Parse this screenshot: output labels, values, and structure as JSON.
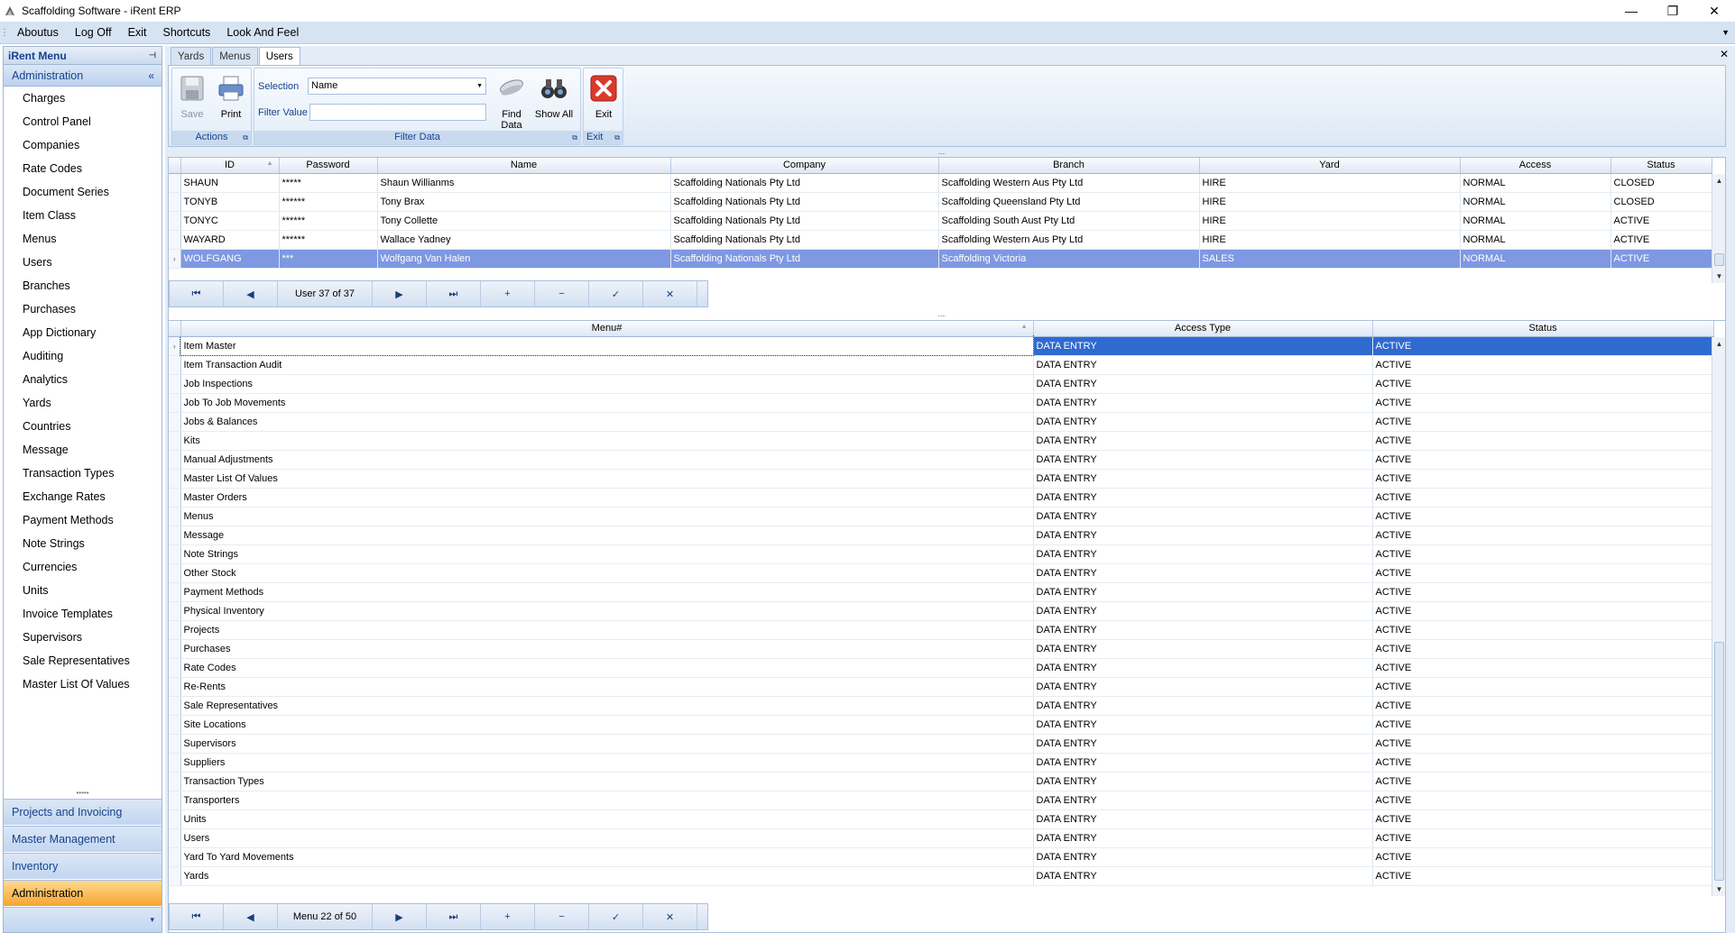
{
  "window": {
    "title": "Scaffolding Software - iRent ERP",
    "controls": [
      "—",
      "❐",
      "✕"
    ]
  },
  "menubar": {
    "items": [
      "Aboutus",
      "Log Off",
      "Exit",
      "Shortcuts",
      "Look And Feel"
    ]
  },
  "nav": {
    "header": "iRent Menu",
    "group": "Administration",
    "items": [
      "Charges",
      "Control Panel",
      "Companies",
      "Rate Codes",
      "Document Series",
      "Item Class",
      "Menus",
      "Users",
      "Branches",
      "Purchases",
      "App Dictionary",
      "Auditing",
      "Analytics",
      "Yards",
      "Countries",
      "Message",
      "Transaction Types",
      "Exchange Rates",
      "Payment Methods",
      "Note Strings",
      "Currencies",
      "Units",
      "Invoice Templates",
      "Supervisors",
      "Sale Representatives",
      "Master List Of Values"
    ],
    "bottom_groups": [
      "Projects and Invoicing",
      "Master Management",
      "Inventory",
      "Administration"
    ]
  },
  "tabs": [
    "Yards",
    "Menus",
    "Users"
  ],
  "ribbon": {
    "actions": {
      "label": "Actions",
      "save": "Save",
      "print": "Print"
    },
    "filter": {
      "label": "Filter Data",
      "selection_label": "Selection",
      "selection_value": "Name",
      "filter_value_label": "Filter Value",
      "filter_value": "",
      "find": "Find Data",
      "show_all": "Show All"
    },
    "exit": {
      "label": "Exit",
      "button": "Exit"
    }
  },
  "users_grid": {
    "columns": [
      "ID",
      "Password",
      "Name",
      "Company",
      "Branch",
      "Yard",
      "Access",
      "Status"
    ],
    "rows": [
      [
        "SHAUN",
        "*****",
        "Shaun Willianms",
        "Scaffolding Nationals Pty Ltd",
        "Scaffolding Western Aus Pty Ltd",
        "HIRE",
        "NORMAL",
        "CLOSED"
      ],
      [
        "TONYB",
        "******",
        "Tony Brax",
        "Scaffolding Nationals Pty Ltd",
        "Scaffolding Queensland Pty Ltd",
        "HIRE",
        "NORMAL",
        "CLOSED"
      ],
      [
        "TONYC",
        "******",
        "Tony Collette",
        "Scaffolding Nationals Pty Ltd",
        "Scaffolding South Aust Pty Ltd",
        "HIRE",
        "NORMAL",
        "ACTIVE"
      ],
      [
        "WAYARD",
        "******",
        "Wallace Yadney",
        "Scaffolding Nationals Pty Ltd",
        "Scaffolding Western Aus Pty Ltd",
        "HIRE",
        "NORMAL",
        "ACTIVE"
      ],
      [
        "WOLFGANG",
        "***",
        "Wolfgang Van Halen",
        "Scaffolding Nationals Pty Ltd",
        "Scaffolding Victoria",
        "SALES",
        "NORMAL",
        "ACTIVE"
      ]
    ],
    "navigator": "User 37 of 37"
  },
  "menus_grid": {
    "columns": [
      "Menu#",
      "Access Type",
      "Status"
    ],
    "rows": [
      [
        "Item Master",
        "DATA ENTRY",
        "ACTIVE"
      ],
      [
        "Item Transaction Audit",
        "DATA ENTRY",
        "ACTIVE"
      ],
      [
        "Job Inspections",
        "DATA ENTRY",
        "ACTIVE"
      ],
      [
        "Job To Job Movements",
        "DATA ENTRY",
        "ACTIVE"
      ],
      [
        "Jobs & Balances",
        "DATA ENTRY",
        "ACTIVE"
      ],
      [
        "Kits",
        "DATA ENTRY",
        "ACTIVE"
      ],
      [
        "Manual Adjustments",
        "DATA ENTRY",
        "ACTIVE"
      ],
      [
        "Master List Of Values",
        "DATA ENTRY",
        "ACTIVE"
      ],
      [
        "Master Orders",
        "DATA ENTRY",
        "ACTIVE"
      ],
      [
        "Menus",
        "DATA ENTRY",
        "ACTIVE"
      ],
      [
        "Message",
        "DATA ENTRY",
        "ACTIVE"
      ],
      [
        "Note Strings",
        "DATA ENTRY",
        "ACTIVE"
      ],
      [
        "Other Stock",
        "DATA ENTRY",
        "ACTIVE"
      ],
      [
        "Payment Methods",
        "DATA ENTRY",
        "ACTIVE"
      ],
      [
        "Physical Inventory",
        "DATA ENTRY",
        "ACTIVE"
      ],
      [
        "Projects",
        "DATA ENTRY",
        "ACTIVE"
      ],
      [
        "Purchases",
        "DATA ENTRY",
        "ACTIVE"
      ],
      [
        "Rate Codes",
        "DATA ENTRY",
        "ACTIVE"
      ],
      [
        "Re-Rents",
        "DATA ENTRY",
        "ACTIVE"
      ],
      [
        "Sale Representatives",
        "DATA ENTRY",
        "ACTIVE"
      ],
      [
        "Site Locations",
        "DATA ENTRY",
        "ACTIVE"
      ],
      [
        "Supervisors",
        "DATA ENTRY",
        "ACTIVE"
      ],
      [
        "Suppliers",
        "DATA ENTRY",
        "ACTIVE"
      ],
      [
        "Transaction Types",
        "DATA ENTRY",
        "ACTIVE"
      ],
      [
        "Transporters",
        "DATA ENTRY",
        "ACTIVE"
      ],
      [
        "Units",
        "DATA ENTRY",
        "ACTIVE"
      ],
      [
        "Users",
        "DATA ENTRY",
        "ACTIVE"
      ],
      [
        "Yard To Yard Movements",
        "DATA ENTRY",
        "ACTIVE"
      ],
      [
        "Yards",
        "DATA ENTRY",
        "ACTIVE"
      ]
    ],
    "navigator": "Menu 22 of 50"
  },
  "nav_buttons": [
    "⏮",
    "◀",
    "▶",
    "⏭",
    "+",
    "−",
    "✓",
    "✕"
  ]
}
